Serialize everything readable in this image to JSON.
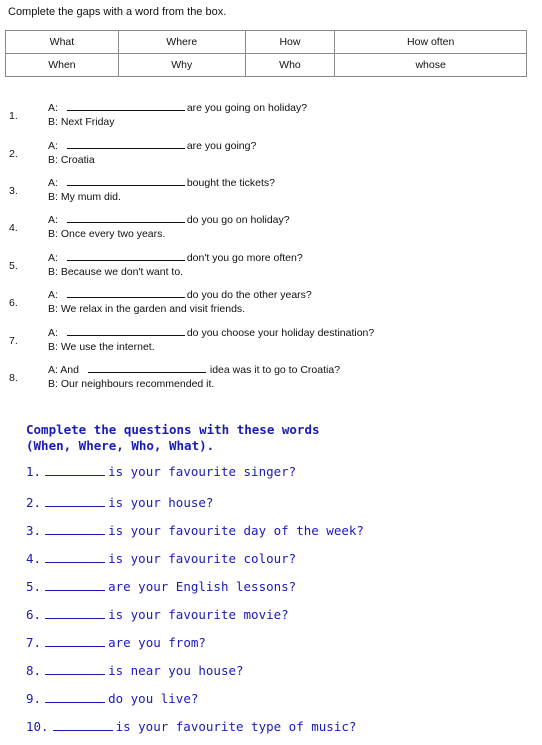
{
  "section1": {
    "title": "Complete the gaps with a word from the box.",
    "box_rows": [
      [
        "What",
        "Where",
        "How",
        "How often"
      ],
      [
        "When",
        "Why",
        "Who",
        "whose"
      ]
    ],
    "exercises": [
      {
        "num": "1.",
        "a_prefix": "A:",
        "a_suffix": "are you going on holiday?",
        "b": "B:  Next Friday"
      },
      {
        "num": "2.",
        "a_prefix": "A:",
        "a_suffix": "are you going?",
        "b": "B:  Croatia"
      },
      {
        "num": "3.",
        "a_prefix": "A:",
        "a_suffix": "bought the tickets?",
        "b": "B:  My mum did."
      },
      {
        "num": "4.",
        "a_prefix": "A:",
        "a_suffix": "do you go on holiday?",
        "b": "B:  Once every two years."
      },
      {
        "num": "5.",
        "a_prefix": "A:",
        "a_suffix": "don't you go more often?",
        "b": "B:  Because we don't want to."
      },
      {
        "num": "6.",
        "a_prefix": "A:",
        "a_suffix": "do you do the other years?",
        "b": "B:  We relax in the garden and visit friends."
      },
      {
        "num": "7.",
        "a_prefix": "A:",
        "a_suffix": "do you choose your holiday destination?",
        "b": "B:  We use the internet."
      },
      {
        "num": "8.",
        "a_prefix": "A:  And",
        "a_suffix": "idea was it to go to Croatia?",
        "b": "B:  Our neighbours recommended it."
      }
    ]
  },
  "section2": {
    "title_line1": "Complete the questions with these words",
    "title_line2": "(When, Where, Who, What).",
    "questions": [
      {
        "num": "1.",
        "text": "is your favourite singer?"
      },
      {
        "num": "2.",
        "text": "is your house?"
      },
      {
        "num": "3.",
        "text": "is your favourite day of the week?"
      },
      {
        "num": "4.",
        "text": "is your favourite colour?"
      },
      {
        "num": "5.",
        "text": "are your English lessons?"
      },
      {
        "num": "6.",
        "text": "is your favourite movie?"
      },
      {
        "num": "7.",
        "text": "are you from?"
      },
      {
        "num": "8.",
        "text": "is near you house?"
      },
      {
        "num": "9.",
        "text": "do you live?"
      },
      {
        "num": "10.",
        "text": "is your favourite type of music?"
      }
    ]
  }
}
